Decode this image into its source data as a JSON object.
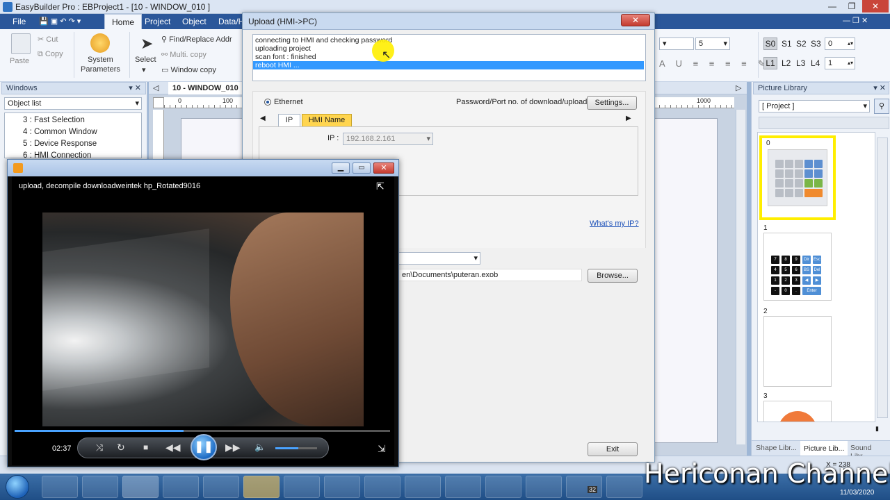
{
  "app": {
    "title": "EasyBuilder Pro : EBProject1 - [10 - WINDOW_010 ]",
    "tabs": [
      "File",
      "Home",
      "Project",
      "Object",
      "Data/H"
    ],
    "active_tab": "Home"
  },
  "ribbon": {
    "paste": "Paste",
    "cut": "Cut",
    "copy": "Copy",
    "system_parameters_1": "System",
    "system_parameters_2": "Parameters",
    "select": "Select",
    "find_replace": "Find/Replace Addr",
    "multi_copy": "Multi. copy",
    "window_copy": "Window copy",
    "font_size_value": "5",
    "s_buttons": [
      "S0",
      "S1",
      "S2",
      "S3"
    ],
    "s_value": "0",
    "l_buttons": [
      "L1",
      "L2",
      "L3",
      "L4"
    ],
    "l_value": "1"
  },
  "windows_panel": {
    "title": "Windows",
    "dropdown": "Object list",
    "items": [
      "3 : Fast Selection",
      "4 : Common Window",
      "5 : Device Response",
      "6 : HMI Connection"
    ]
  },
  "editor": {
    "tab": "10 - WINDOW_010",
    "ruler_labels": [
      "0",
      "100",
      "1000"
    ]
  },
  "upload_dialog": {
    "title": "Upload (HMI->PC)",
    "log": [
      "connecting to HMI and checking password",
      "uploading project",
      "scan font : finished",
      "reboot HMI ..."
    ],
    "selected_log_index": 3,
    "connection": "Ethernet",
    "password_label": "Password/Port no. of download/upload :",
    "settings_button": "Settings...",
    "subtabs": [
      "IP",
      "HMI Name"
    ],
    "ip_label": "IP :",
    "ip_value": "192.168.2.161",
    "whats_my_ip": "What's my IP?",
    "path_value": "en\\Documents\\puteran.exob",
    "browse_button": "Browse...",
    "exit_button": "Exit"
  },
  "media_player": {
    "video_title": "upload, decompile downloadweintek hp_Rotated9016",
    "time": "02:37",
    "progress": 0.45,
    "volume": 0.55
  },
  "picture_library": {
    "title": "Picture Library",
    "dropdown": "[ Project ]",
    "items": [
      "0",
      "1",
      "2",
      "3"
    ],
    "keypad_labels": [
      "7",
      "8",
      "9",
      "Dir",
      "Esc",
      "4",
      "5",
      "6",
      "BS",
      "Del",
      "1",
      "2",
      "3",
      "◀",
      "▶",
      "-",
      "0",
      ".",
      "Enter"
    ],
    "bottom_tabs": [
      "Shape Libr...",
      "Picture Lib...",
      "Sound Libr..."
    ],
    "active_bottom_tab": "Picture Lib...",
    "status": "X = 238"
  },
  "taskbar": {
    "date": "11/03/2020",
    "badge": "32"
  },
  "watermark": "Hericonan Channel",
  "colors": {
    "ribbon_tab_bg": "#2b579a",
    "selection_blue": "#3399ff",
    "hmi_name_tab": "#ffd54f",
    "highlight_yellow": "#ffee00"
  }
}
